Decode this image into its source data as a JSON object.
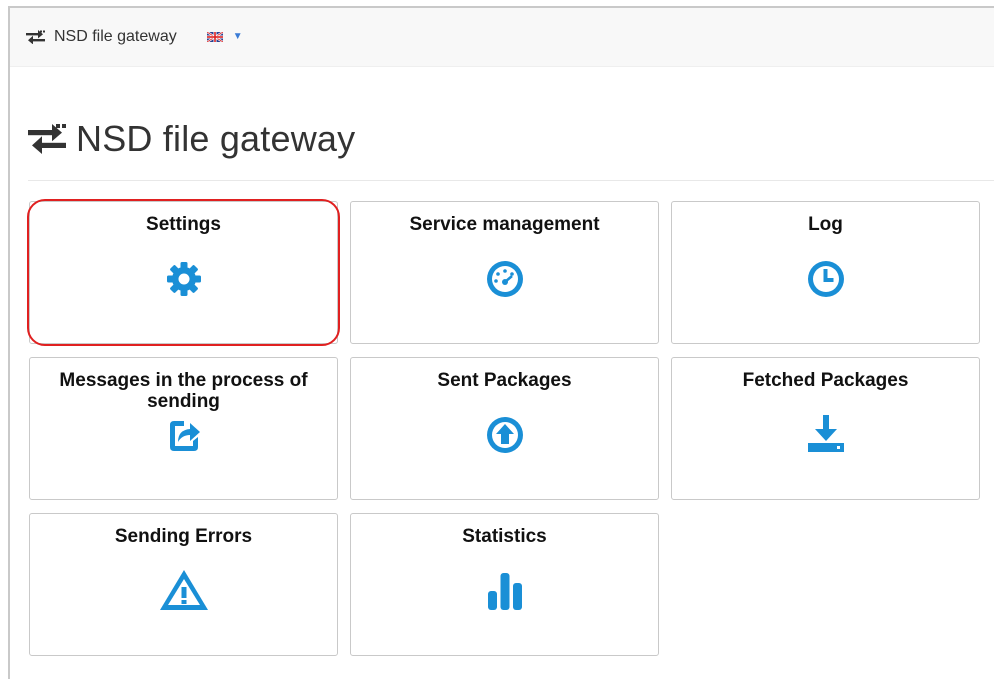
{
  "navbar": {
    "brand": "NSD file gateway",
    "brand_icon": "exchange-arrows-icon",
    "language_icon": "uk-flag-icon",
    "language_caret": "▼"
  },
  "page": {
    "title": "NSD file gateway",
    "title_icon": "exchange-arrows-icon"
  },
  "accent_color": "#1a8fd6",
  "highlight_color": "#e02020",
  "tiles": [
    {
      "label": "Settings",
      "icon": "gear-icon",
      "highlighted": true
    },
    {
      "label": "Service management",
      "icon": "dashboard-icon"
    },
    {
      "label": "Log",
      "icon": "clock-icon"
    },
    {
      "label": "Messages in the process of sending",
      "icon": "share-icon"
    },
    {
      "label": "Sent Packages",
      "icon": "upload-circle-icon"
    },
    {
      "label": "Fetched Packages",
      "icon": "download-tray-icon"
    },
    {
      "label": "Sending Errors",
      "icon": "warning-triangle-icon"
    },
    {
      "label": "Statistics",
      "icon": "bar-chart-icon"
    }
  ]
}
